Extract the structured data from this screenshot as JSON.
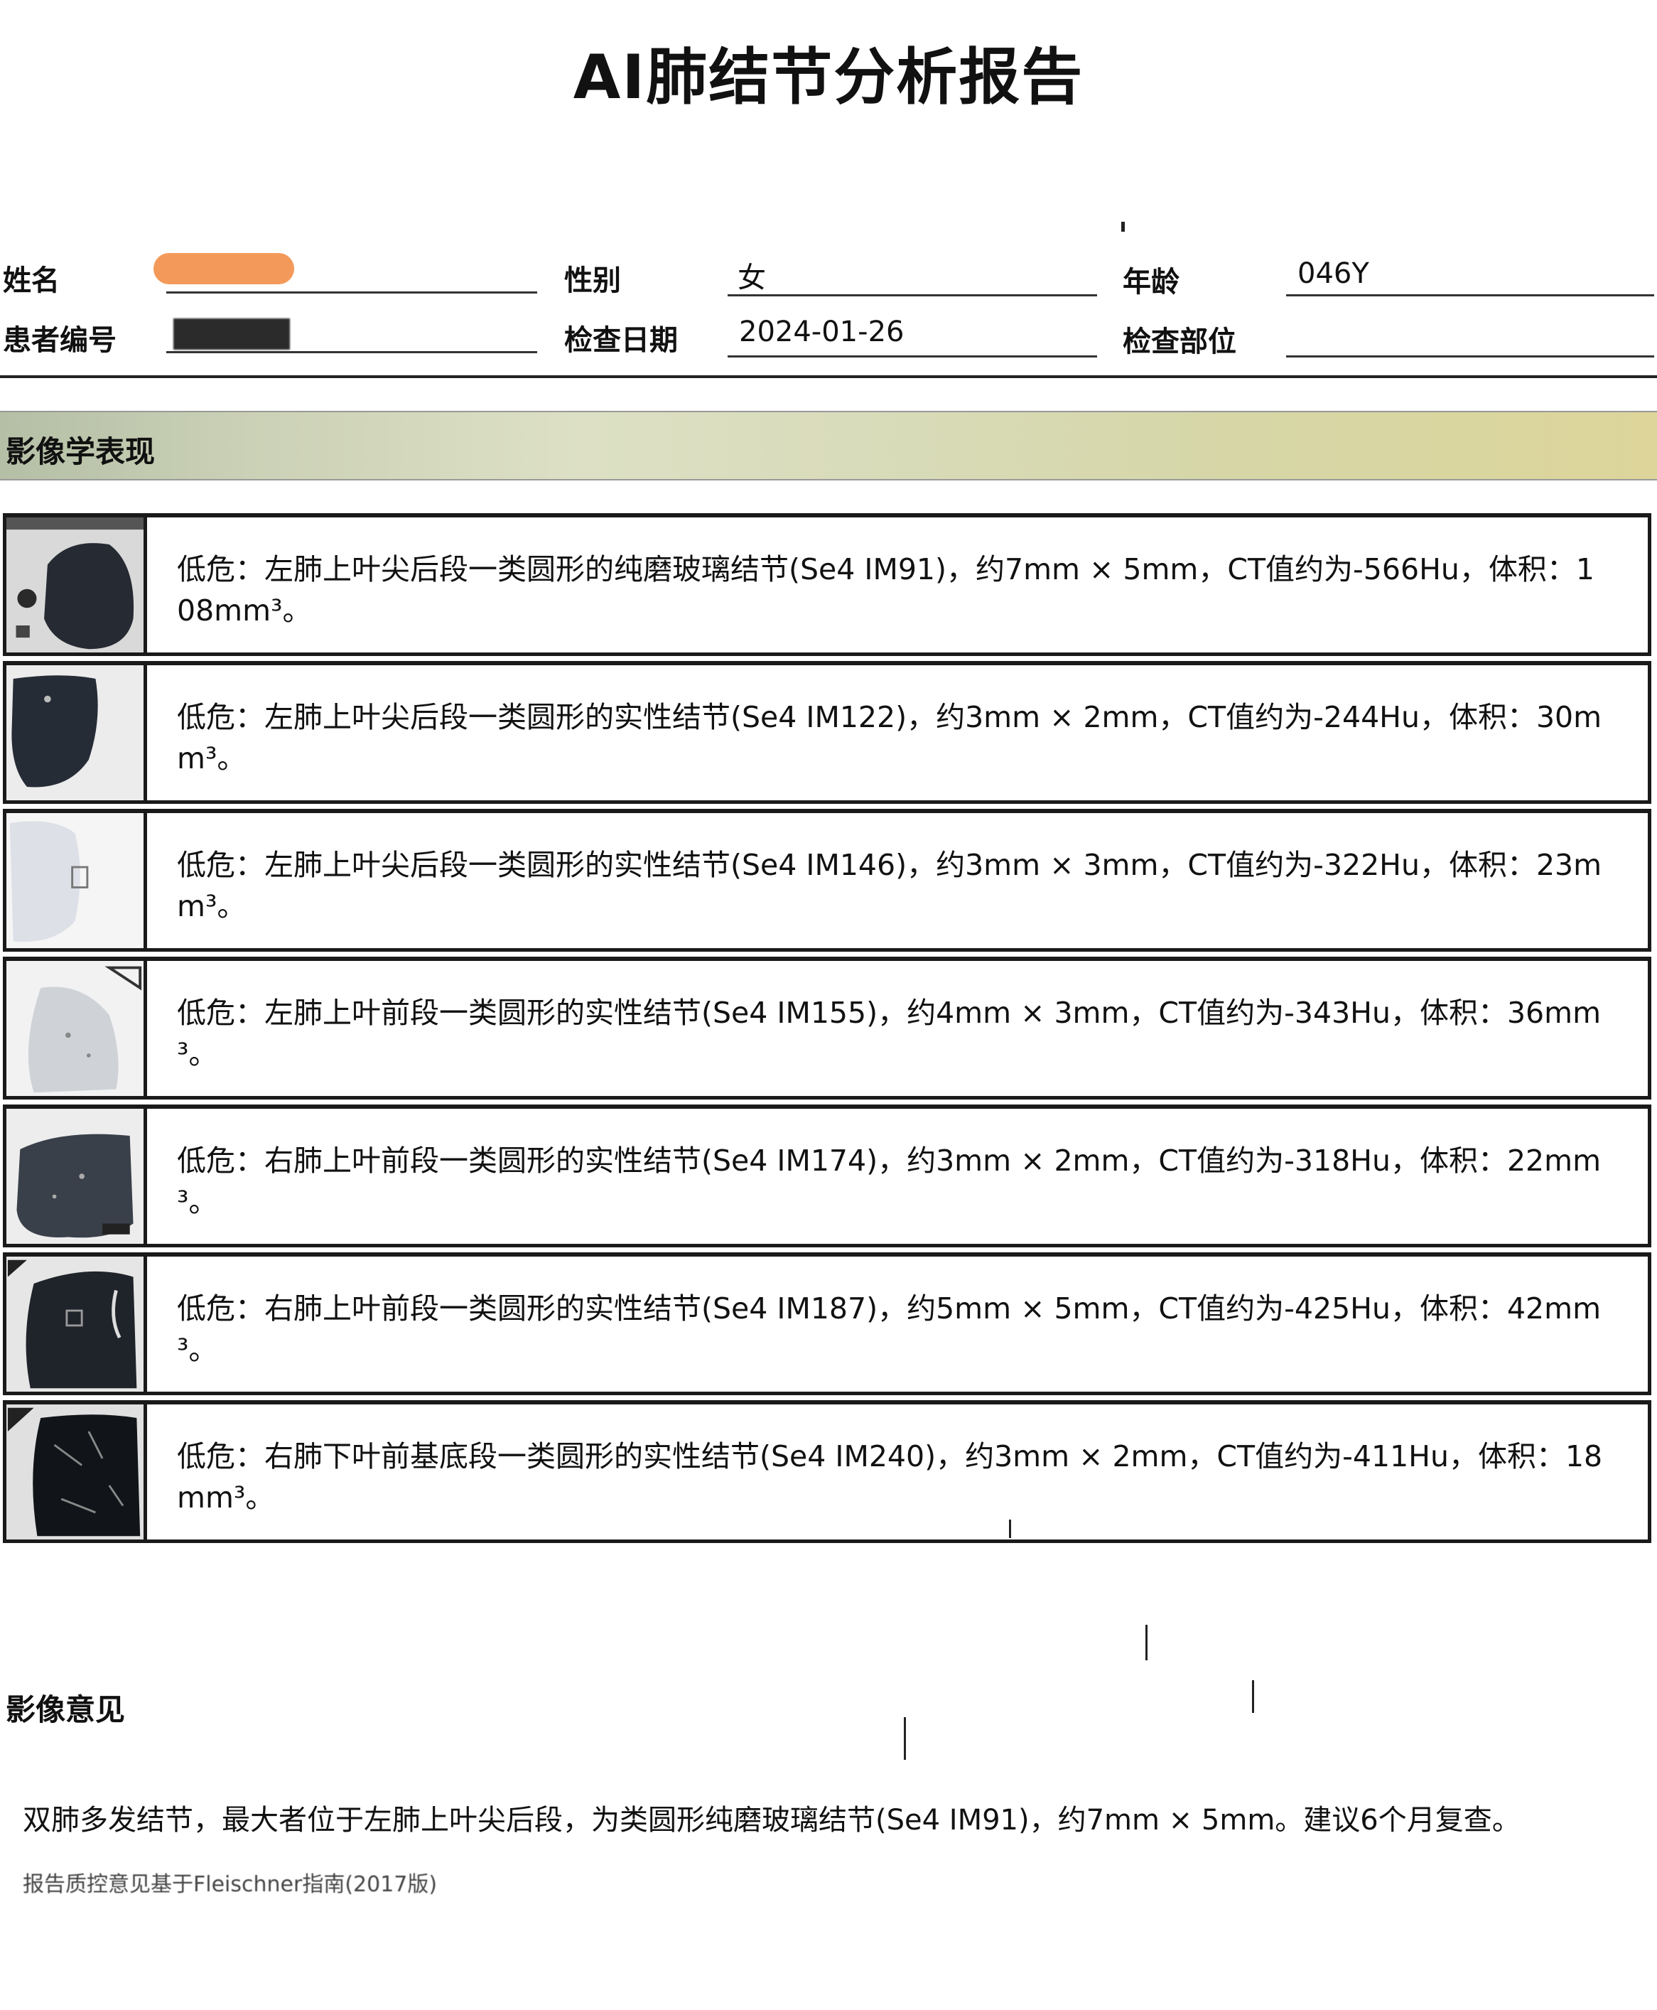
{
  "title": "AI肺结节分析报告",
  "patient": {
    "name_label": "姓名",
    "name_value": "",
    "gender_label": "性别",
    "gender_value": "女",
    "age_label": "年龄",
    "age_value": "046Y",
    "id_label": "患者编号",
    "id_value": "",
    "date_label": "检查日期",
    "date_value": "2024-01-26",
    "part_label": "检查部位",
    "part_value": ""
  },
  "section_findings_label": "影像学表现",
  "findings": [
    {
      "text": "低危：左肺上叶尖后段一类圆形的纯磨玻璃结节(Se4 IM91)，约7mm × 5mm，CT值约为-566Hu，体积：108mm³。"
    },
    {
      "text": "低危：左肺上叶尖后段一类圆形的实性结节(Se4 IM122)，约3mm × 2mm，CT值约为-244Hu，体积：30mm³。"
    },
    {
      "text": "低危：左肺上叶尖后段一类圆形的实性结节(Se4 IM146)，约3mm × 3mm，CT值约为-322Hu，体积：23mm³。"
    },
    {
      "text": "低危：左肺上叶前段一类圆形的实性结节(Se4 IM155)，约4mm × 3mm，CT值约为-343Hu，体积：36mm³。"
    },
    {
      "text": "低危：右肺上叶前段一类圆形的实性结节(Se4 IM174)，约3mm × 2mm，CT值约为-318Hu，体积：22mm³。"
    },
    {
      "text": "低危：右肺上叶前段一类圆形的实性结节(Se4 IM187)，约5mm × 5mm，CT值约为-425Hu，体积：42mm³。"
    },
    {
      "text": "低危：右肺下叶前基底段一类圆形的实性结节(Se4 IM240)，约3mm × 2mm，CT值约为-411Hu，体积：18mm³。"
    }
  ],
  "section_opinion_label": "影像意见",
  "opinion_text": "双肺多发结节，最大者位于左肺上叶尖后段，为类圆形纯磨玻璃结节(Se4 IM91)，约7mm × 5mm。建议6个月复查。",
  "footnote": "报告质控意见基于Fleischner指南(2017版)"
}
